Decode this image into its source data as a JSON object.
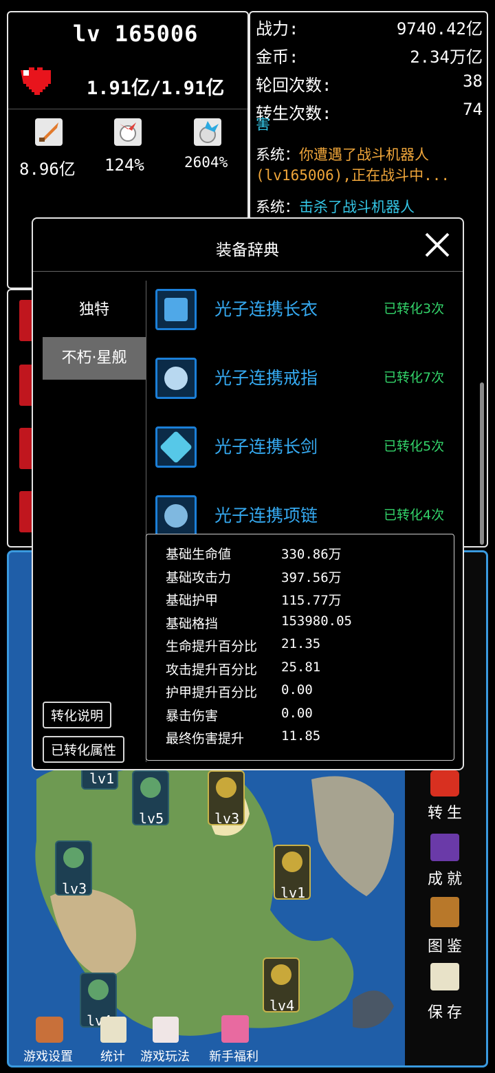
{
  "player": {
    "level": "lv 165006",
    "hp": "1.91亿/1.91亿",
    "stats": [
      "8.96亿",
      "124%",
      "2604%"
    ]
  },
  "info": {
    "rows": [
      {
        "label": "战力:",
        "value": "9740.42亿"
      },
      {
        "label": "金币:",
        "value": "2.34万亿"
      },
      {
        "label": "轮回次数:",
        "value": "38"
      },
      {
        "label": "转生次数:",
        "value": "74"
      }
    ],
    "log": [
      {
        "text": "害",
        "color": "cyan"
      },
      {
        "prefix": "系统：",
        "text": "你遭遇了战斗机器人(lv165006),正在战斗中...",
        "color": "orange"
      },
      {
        "prefix": "系统：",
        "text": "击杀了战斗机器人",
        "color": "cyan"
      }
    ]
  },
  "modal": {
    "title": "装备辞典",
    "tabs": [
      "独特",
      "不朽·星舰"
    ],
    "active_tab": "不朽·星舰",
    "items": [
      {
        "name": "光子连携长衣",
        "count": "已转化3次",
        "icon": "armor-icon"
      },
      {
        "name": "光子连携戒指",
        "count": "已转化7次",
        "icon": "ring-icon"
      },
      {
        "name": "光子连携长剑",
        "count": "已转化5次",
        "icon": "sword-icon"
      },
      {
        "name": "光子连携项链",
        "count": "已转化4次",
        "icon": "necklace-icon"
      }
    ],
    "attributes": [
      {
        "label": "基础生命値",
        "value": "330.86万"
      },
      {
        "label": "基础攻击力",
        "value": "397.56万"
      },
      {
        "label": "基础护甲",
        "value": "115.77万"
      },
      {
        "label": "基础格挡",
        "value": "153980.05"
      },
      {
        "label": "生命提升百分比",
        "value": "21.35"
      },
      {
        "label": "攻击提升百分比",
        "value": "25.81"
      },
      {
        "label": "护甲提升百分比",
        "value": "0.00"
      },
      {
        "label": "暴击伤害",
        "value": "0.00"
      },
      {
        "label": "最终伤害提升",
        "value": "11.85"
      }
    ],
    "buttons": {
      "explain": "转化说明",
      "converted": "已转化属性"
    }
  },
  "map": {
    "nodes": [
      "lv1",
      "lv5",
      "lv3",
      "lv3",
      "lv1",
      "lv4",
      "lv4"
    ],
    "side_menu": [
      "转生",
      "成就",
      "图鉴",
      "保存"
    ],
    "bottom_menu": [
      "游戏设置",
      "统计",
      "游戏玩法",
      "新手福利"
    ]
  },
  "colors": {
    "accent": "#35a9f0",
    "success": "#33d46a",
    "warning": "#f0a63a",
    "map_sea": "#1f5ea8"
  }
}
